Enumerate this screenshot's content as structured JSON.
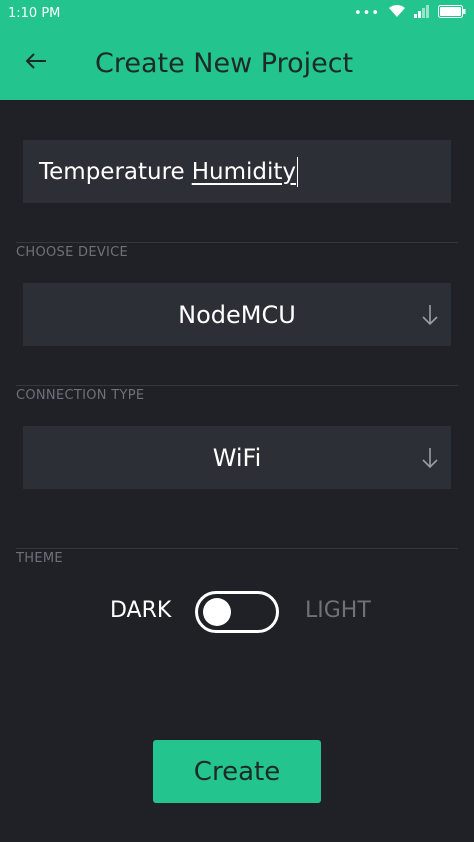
{
  "status_bar": {
    "time": "1:10 PM",
    "dots": "•••",
    "icons": [
      "wifi-icon",
      "signal-icon",
      "battery-icon"
    ]
  },
  "app_bar": {
    "title": "Create New Project",
    "back_icon": "arrow-left-icon"
  },
  "project_name": {
    "word1": "Temperature",
    "word2": "Humidity"
  },
  "device": {
    "label": "CHOOSE DEVICE",
    "value": "NodeMCU",
    "icon": "arrow-down-icon"
  },
  "connection": {
    "label": "CONNECTION TYPE",
    "value": "WiFi",
    "icon": "arrow-down-icon"
  },
  "theme": {
    "label": "THEME",
    "dark": "DARK",
    "light": "LIGHT",
    "selected": "DARK"
  },
  "create_button": {
    "label": "Create"
  },
  "colors": {
    "accent": "#23c48e",
    "background": "#1f2126",
    "field": "#2c2f35",
    "muted_text": "#6e7178"
  }
}
